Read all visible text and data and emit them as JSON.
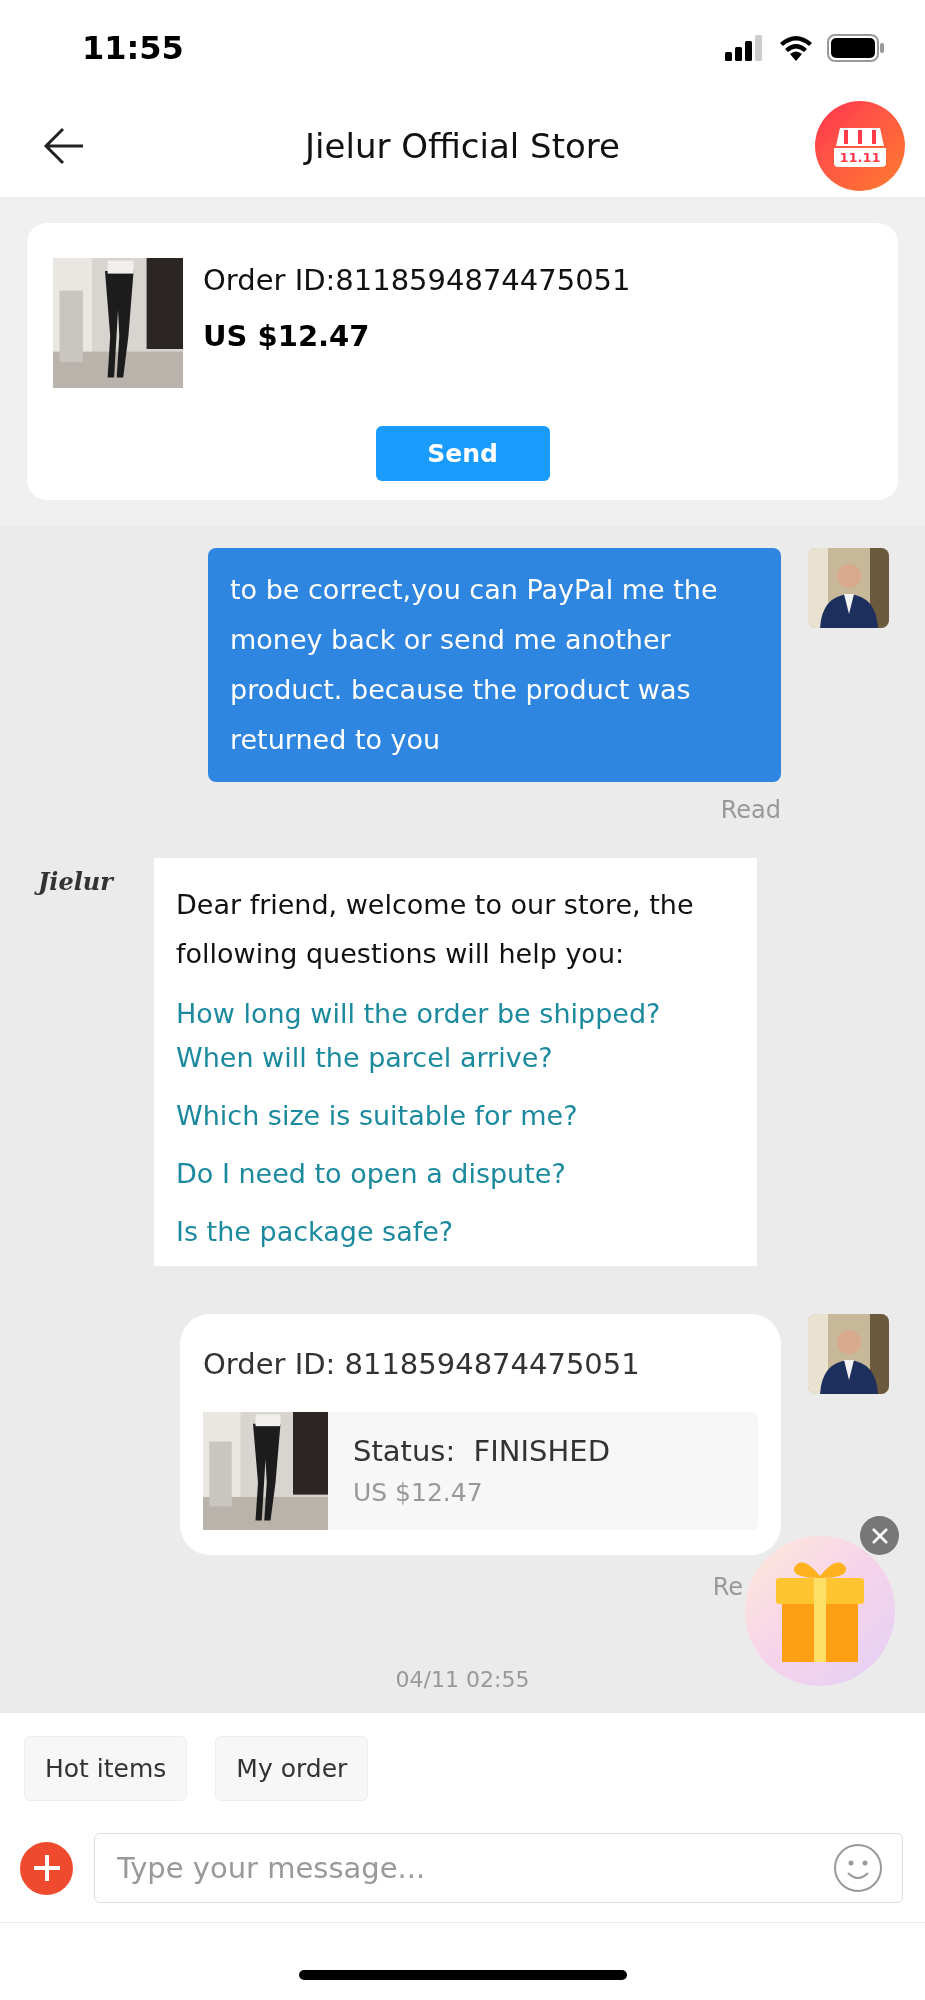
{
  "status_bar": {
    "time": "11:55"
  },
  "header": {
    "title": "Jielur Official Store",
    "store_badge": "11.11"
  },
  "order_card": {
    "order_id": "Order ID:8118594874475051",
    "price": "US $12.47",
    "button": "Send"
  },
  "messages": [
    {
      "kind": "text",
      "text": "to be correct,you can PayPal me the money back or send me another product. because the product was returned to you",
      "read": "Read"
    },
    {
      "kind": "faq",
      "logo": "Jielur",
      "intro": "Dear friend, welcome to our store, the following questions will help you:",
      "links": [
        "How long will the order be shipped? When will the parcel arrive?",
        "Which size is suitable for me?",
        "Do I need to open a dispute?",
        "Is the package safe?"
      ]
    },
    {
      "kind": "order",
      "order_id": "Order ID: 8118594874475051",
      "status": "Status:  FINISHED",
      "price": "US $12.47",
      "read": "Re"
    }
  ],
  "timestamp": "04/11 02:55",
  "quick_replies": [
    "Hot items",
    "My order"
  ],
  "composer": {
    "placeholder": "Type your message..."
  }
}
